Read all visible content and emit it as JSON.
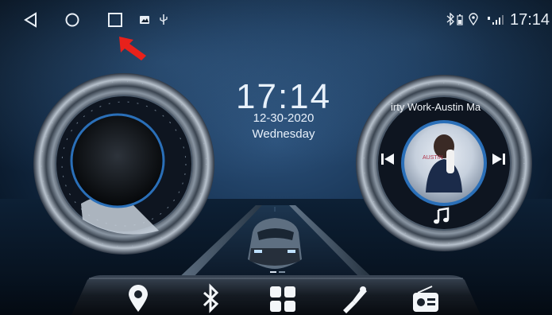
{
  "status_bar": {
    "time": "17:14",
    "nav_icons": [
      "back-icon",
      "home-icon",
      "recent-apps-icon"
    ],
    "notification_icons": [
      "image-icon",
      "usb-icon"
    ],
    "system_icons": [
      "bluetooth-icon",
      "battery-icon",
      "location-icon",
      "signal-icon"
    ]
  },
  "clock": {
    "time": "17:14",
    "date": "12-30-2020",
    "day": "Wednesday"
  },
  "music": {
    "track_title": "irty Work-Austin Ma",
    "controls": [
      "previous-icon",
      "next-icon",
      "music-note-icon"
    ]
  },
  "dock": {
    "items": [
      "location-icon",
      "bluetooth-icon",
      "apps-grid-icon",
      "settings-tools-icon",
      "radio-icon"
    ]
  },
  "colors": {
    "text": "#e8eef5",
    "accent_blue": "#2a6fb8",
    "pointer_red": "#e8211b"
  }
}
